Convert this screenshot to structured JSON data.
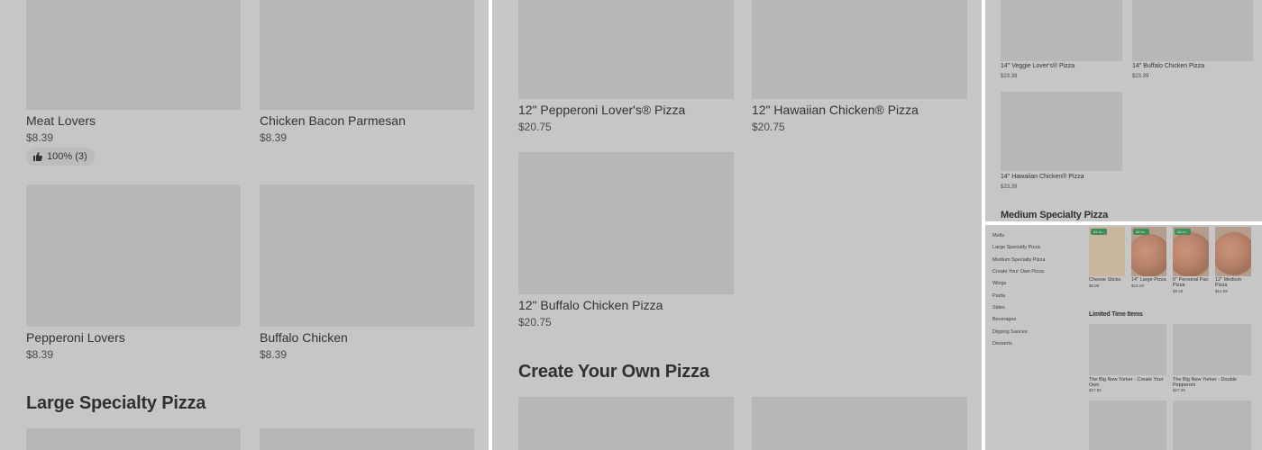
{
  "panel1": {
    "items": [
      {
        "name": "Meat Lovers",
        "price": "$8.39"
      },
      {
        "name": "Chicken Bacon Parmesan",
        "price": "$8.39"
      },
      {
        "name": "Pepperoni Lovers",
        "price": "$8.39"
      },
      {
        "name": "Buffalo Chicken",
        "price": "$8.39"
      }
    ],
    "rating": {
      "icon": "thumbs-up-icon",
      "text": "100% (3)"
    },
    "section_heading": "Large Specialty Pizza"
  },
  "panel2": {
    "items": [
      {
        "name": "12\" Pepperoni Lover's® Pizza",
        "price": "$20.75"
      },
      {
        "name": "12\" Hawaiian Chicken® Pizza",
        "price": "$20.75"
      },
      {
        "name": "12\" Buffalo Chicken Pizza",
        "price": "$20.75"
      }
    ],
    "section_heading": "Create Your Own Pizza"
  },
  "panel3": {
    "items": [
      {
        "name": "14\" Veggie Lover's® Pizza",
        "price": "$23.39"
      },
      {
        "name": "14\" Buffalo Chicken Pizza",
        "price": "$23.39"
      },
      {
        "name": "14\" Hawaiian Chicken® Pizza",
        "price": "$23.39"
      }
    ],
    "section_heading": "Medium Specialty Pizza"
  },
  "panel4": {
    "nav": [
      "Melts",
      "Large Specialty Pizza",
      "Medium Specialty Pizza",
      "Create Your Own Pizza",
      "Wings",
      "Pasta",
      "Sides",
      "Beverages",
      "Dipping Sauces",
      "Desserts"
    ],
    "featured": [
      {
        "name": "Cheese Sticks",
        "price": "$8.99",
        "badge": "#1 m..."
      },
      {
        "name": "14\" Large Pizza",
        "price": "$18.19",
        "badge": "#2 m..."
      },
      {
        "name": "6\" Personal Pan Pizza",
        "price": "$9.19",
        "badge": "#3 m..."
      },
      {
        "name": "12\" Medium Pizza",
        "price": "$14.59",
        "badge": ""
      }
    ],
    "section_heading": "Limited Time Items",
    "limited": [
      {
        "name": "The Big New Yorker - Create Your Own",
        "price": "$27.99"
      },
      {
        "name": "The Big New Yorker - Double Pepperoni",
        "price": "$27.99"
      }
    ]
  },
  "colors": {
    "overlay": "#c6c6c6",
    "image_placeholder": "#b7b7b7",
    "badge": "#3f8c5a",
    "divider": "#ffffff"
  }
}
